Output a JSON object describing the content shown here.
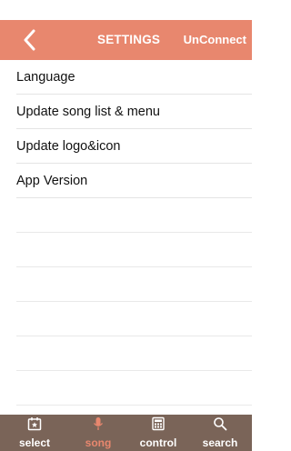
{
  "navbar": {
    "title": "SETTINGS",
    "right_action": "UnConnect",
    "back_icon": "chevron-left-icon",
    "background": "#e8876e"
  },
  "settings": {
    "items": [
      {
        "label": "Language"
      },
      {
        "label": "Update song list & menu"
      },
      {
        "label": "Update logo&icon"
      },
      {
        "label": "App Version"
      }
    ]
  },
  "tabbar": {
    "background": "#7a6458",
    "active_color": "#e8876e",
    "tabs": [
      {
        "label": "select",
        "icon": "calendar-star-icon",
        "active": false
      },
      {
        "label": "song",
        "icon": "microphone-icon",
        "active": true
      },
      {
        "label": "control",
        "icon": "keypad-icon",
        "active": false
      },
      {
        "label": "search",
        "icon": "search-icon",
        "active": false
      }
    ]
  }
}
